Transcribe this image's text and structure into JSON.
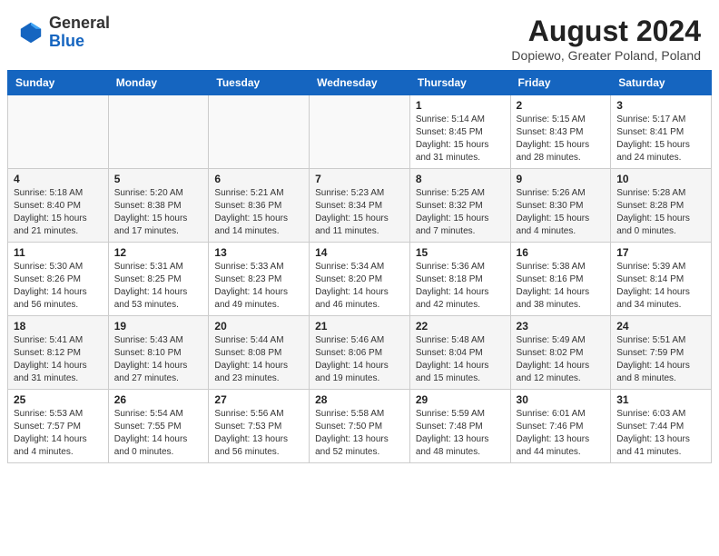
{
  "header": {
    "logo_general": "General",
    "logo_blue": "Blue",
    "month_year": "August 2024",
    "location": "Dopiewo, Greater Poland, Poland"
  },
  "days_of_week": [
    "Sunday",
    "Monday",
    "Tuesday",
    "Wednesday",
    "Thursday",
    "Friday",
    "Saturday"
  ],
  "weeks": [
    {
      "row_style": "row-odd",
      "days": [
        {
          "num": "",
          "empty": true
        },
        {
          "num": "",
          "empty": true
        },
        {
          "num": "",
          "empty": true
        },
        {
          "num": "",
          "empty": true
        },
        {
          "num": "1",
          "empty": false,
          "info": "Sunrise: 5:14 AM\nSunset: 8:45 PM\nDaylight: 15 hours\nand 31 minutes."
        },
        {
          "num": "2",
          "empty": false,
          "info": "Sunrise: 5:15 AM\nSunset: 8:43 PM\nDaylight: 15 hours\nand 28 minutes."
        },
        {
          "num": "3",
          "empty": false,
          "info": "Sunrise: 5:17 AM\nSunset: 8:41 PM\nDaylight: 15 hours\nand 24 minutes."
        }
      ]
    },
    {
      "row_style": "row-even",
      "days": [
        {
          "num": "4",
          "empty": false,
          "info": "Sunrise: 5:18 AM\nSunset: 8:40 PM\nDaylight: 15 hours\nand 21 minutes."
        },
        {
          "num": "5",
          "empty": false,
          "info": "Sunrise: 5:20 AM\nSunset: 8:38 PM\nDaylight: 15 hours\nand 17 minutes."
        },
        {
          "num": "6",
          "empty": false,
          "info": "Sunrise: 5:21 AM\nSunset: 8:36 PM\nDaylight: 15 hours\nand 14 minutes."
        },
        {
          "num": "7",
          "empty": false,
          "info": "Sunrise: 5:23 AM\nSunset: 8:34 PM\nDaylight: 15 hours\nand 11 minutes."
        },
        {
          "num": "8",
          "empty": false,
          "info": "Sunrise: 5:25 AM\nSunset: 8:32 PM\nDaylight: 15 hours\nand 7 minutes."
        },
        {
          "num": "9",
          "empty": false,
          "info": "Sunrise: 5:26 AM\nSunset: 8:30 PM\nDaylight: 15 hours\nand 4 minutes."
        },
        {
          "num": "10",
          "empty": false,
          "info": "Sunrise: 5:28 AM\nSunset: 8:28 PM\nDaylight: 15 hours\nand 0 minutes."
        }
      ]
    },
    {
      "row_style": "row-odd",
      "days": [
        {
          "num": "11",
          "empty": false,
          "info": "Sunrise: 5:30 AM\nSunset: 8:26 PM\nDaylight: 14 hours\nand 56 minutes."
        },
        {
          "num": "12",
          "empty": false,
          "info": "Sunrise: 5:31 AM\nSunset: 8:25 PM\nDaylight: 14 hours\nand 53 minutes."
        },
        {
          "num": "13",
          "empty": false,
          "info": "Sunrise: 5:33 AM\nSunset: 8:23 PM\nDaylight: 14 hours\nand 49 minutes."
        },
        {
          "num": "14",
          "empty": false,
          "info": "Sunrise: 5:34 AM\nSunset: 8:20 PM\nDaylight: 14 hours\nand 46 minutes."
        },
        {
          "num": "15",
          "empty": false,
          "info": "Sunrise: 5:36 AM\nSunset: 8:18 PM\nDaylight: 14 hours\nand 42 minutes."
        },
        {
          "num": "16",
          "empty": false,
          "info": "Sunrise: 5:38 AM\nSunset: 8:16 PM\nDaylight: 14 hours\nand 38 minutes."
        },
        {
          "num": "17",
          "empty": false,
          "info": "Sunrise: 5:39 AM\nSunset: 8:14 PM\nDaylight: 14 hours\nand 34 minutes."
        }
      ]
    },
    {
      "row_style": "row-even",
      "days": [
        {
          "num": "18",
          "empty": false,
          "info": "Sunrise: 5:41 AM\nSunset: 8:12 PM\nDaylight: 14 hours\nand 31 minutes."
        },
        {
          "num": "19",
          "empty": false,
          "info": "Sunrise: 5:43 AM\nSunset: 8:10 PM\nDaylight: 14 hours\nand 27 minutes."
        },
        {
          "num": "20",
          "empty": false,
          "info": "Sunrise: 5:44 AM\nSunset: 8:08 PM\nDaylight: 14 hours\nand 23 minutes."
        },
        {
          "num": "21",
          "empty": false,
          "info": "Sunrise: 5:46 AM\nSunset: 8:06 PM\nDaylight: 14 hours\nand 19 minutes."
        },
        {
          "num": "22",
          "empty": false,
          "info": "Sunrise: 5:48 AM\nSunset: 8:04 PM\nDaylight: 14 hours\nand 15 minutes."
        },
        {
          "num": "23",
          "empty": false,
          "info": "Sunrise: 5:49 AM\nSunset: 8:02 PM\nDaylight: 14 hours\nand 12 minutes."
        },
        {
          "num": "24",
          "empty": false,
          "info": "Sunrise: 5:51 AM\nSunset: 7:59 PM\nDaylight: 14 hours\nand 8 minutes."
        }
      ]
    },
    {
      "row_style": "row-odd",
      "days": [
        {
          "num": "25",
          "empty": false,
          "info": "Sunrise: 5:53 AM\nSunset: 7:57 PM\nDaylight: 14 hours\nand 4 minutes."
        },
        {
          "num": "26",
          "empty": false,
          "info": "Sunrise: 5:54 AM\nSunset: 7:55 PM\nDaylight: 14 hours\nand 0 minutes."
        },
        {
          "num": "27",
          "empty": false,
          "info": "Sunrise: 5:56 AM\nSunset: 7:53 PM\nDaylight: 13 hours\nand 56 minutes."
        },
        {
          "num": "28",
          "empty": false,
          "info": "Sunrise: 5:58 AM\nSunset: 7:50 PM\nDaylight: 13 hours\nand 52 minutes."
        },
        {
          "num": "29",
          "empty": false,
          "info": "Sunrise: 5:59 AM\nSunset: 7:48 PM\nDaylight: 13 hours\nand 48 minutes."
        },
        {
          "num": "30",
          "empty": false,
          "info": "Sunrise: 6:01 AM\nSunset: 7:46 PM\nDaylight: 13 hours\nand 44 minutes."
        },
        {
          "num": "31",
          "empty": false,
          "info": "Sunrise: 6:03 AM\nSunset: 7:44 PM\nDaylight: 13 hours\nand 41 minutes."
        }
      ]
    }
  ]
}
